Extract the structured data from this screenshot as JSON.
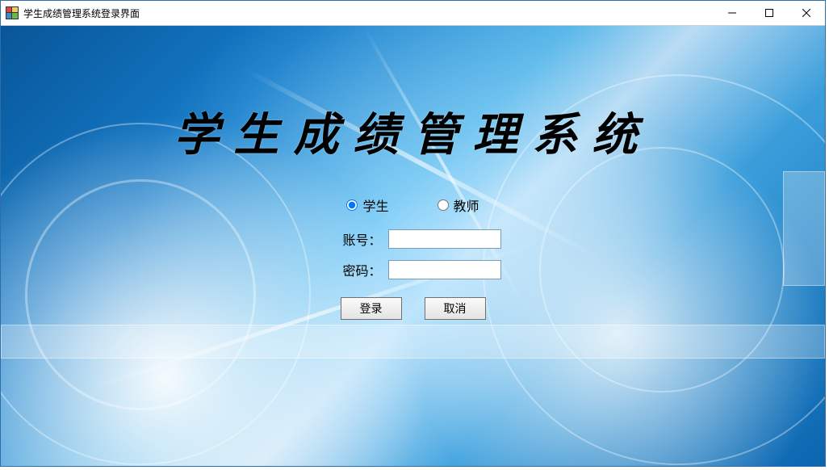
{
  "window": {
    "title": "学生成绩管理系统登录界面"
  },
  "heading": "学生成绩管理系统",
  "role": {
    "student_label": "学生",
    "teacher_label": "教师",
    "selected": "student"
  },
  "fields": {
    "account_label": "账号：",
    "account_value": "",
    "password_label": "密码：",
    "password_value": ""
  },
  "buttons": {
    "login_label": "登录",
    "cancel_label": "取消"
  }
}
